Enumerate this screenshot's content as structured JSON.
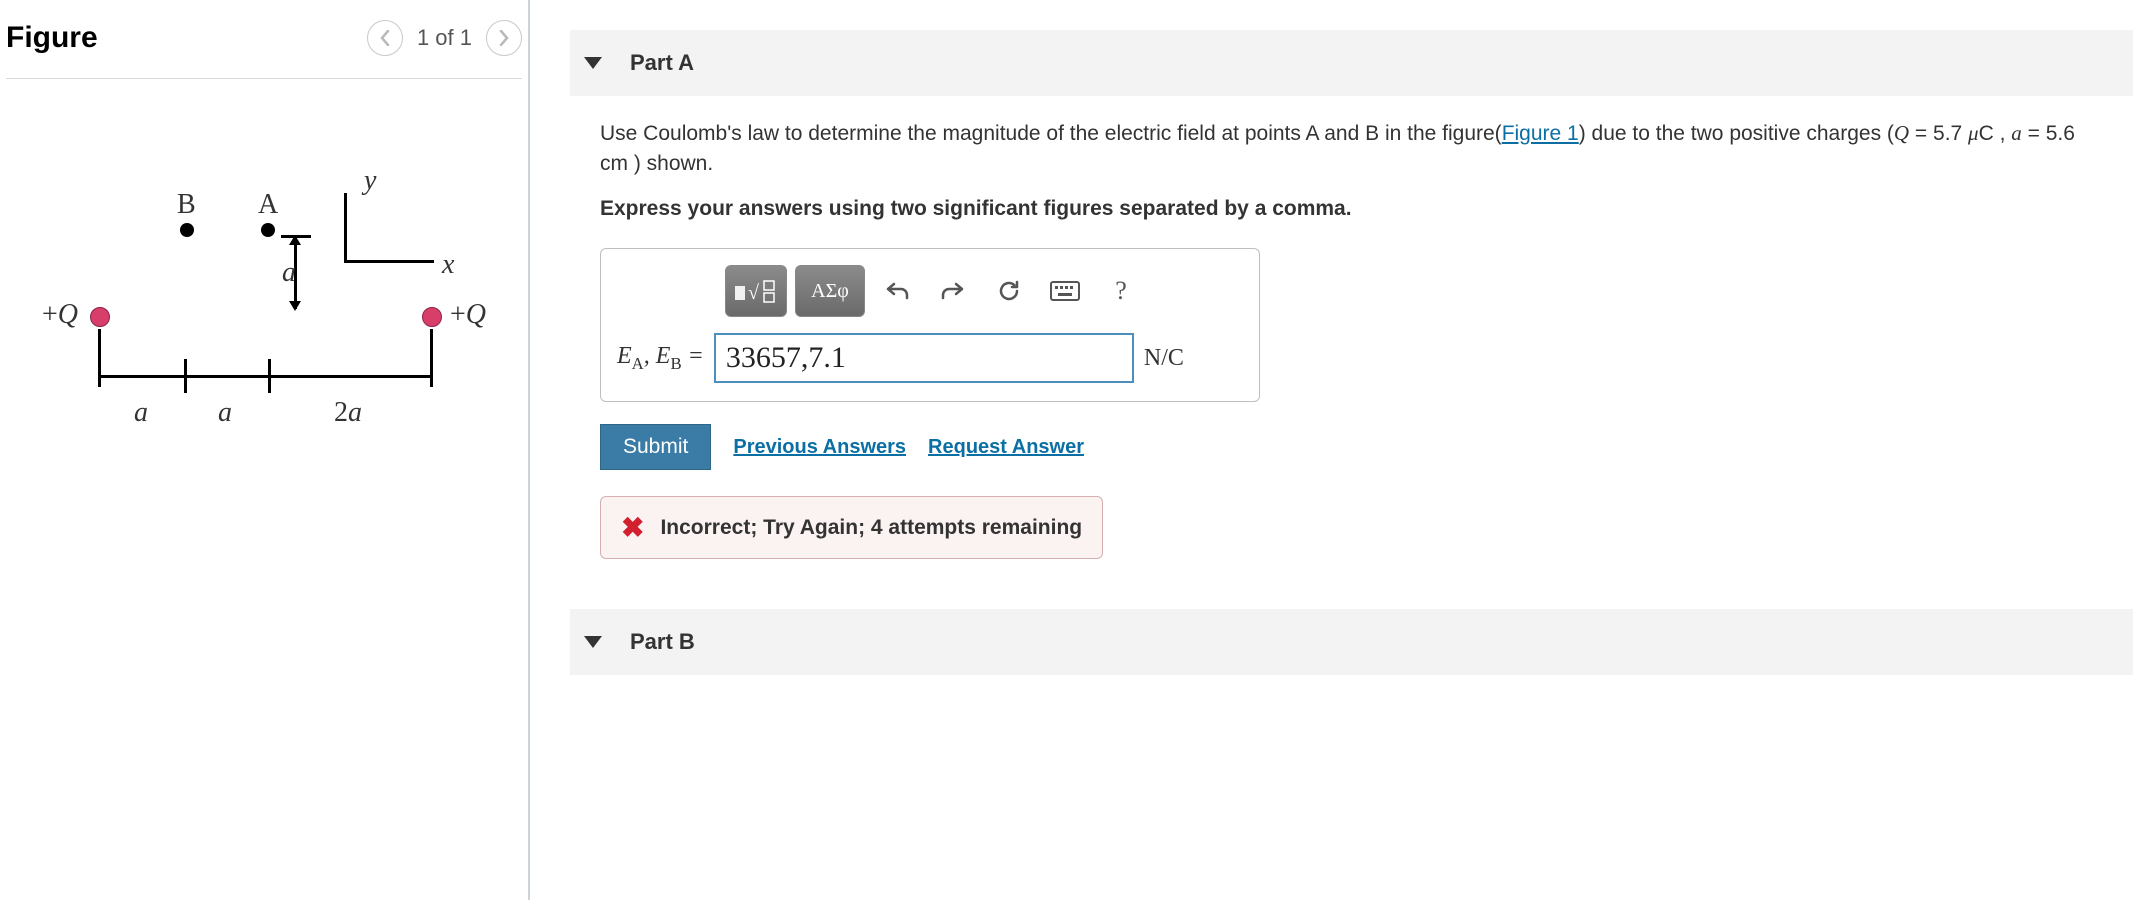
{
  "figure": {
    "title": "Figure",
    "pager": "1 of 1",
    "labels": {
      "B": "B",
      "A": "A",
      "y": "y",
      "x": "x",
      "a": "a",
      "twoa": "2a",
      "plusQ": "+Q"
    }
  },
  "partA": {
    "title": "Part A",
    "prompt_pre": "Use Coulomb's law to determine the magnitude of the electric field at points A and B in the figure(",
    "figure_link": "Figure 1",
    "prompt_post": ") due to the two positive charges (",
    "givens_html": "Q = 5.7 μC , a = 5.6 cm",
    "prompt_end": " ) shown.",
    "instruction": "Express your answers using two significant figures separated by a comma.",
    "toolbar": {
      "templates": "▭√▭",
      "greek": "ΑΣφ"
    },
    "answer_label_pre": "E",
    "answer_label_A": "A",
    "answer_label_sep": ", ",
    "answer_label_B": "B",
    "answer_label_eq": " = ",
    "answer_value": "33657,7.1",
    "answer_unit": "N/C",
    "submit": "Submit",
    "previous": "Previous Answers",
    "request": "Request Answer",
    "feedback": "Incorrect; Try Again; 4 attempts remaining"
  },
  "partB": {
    "title": "Part B"
  }
}
